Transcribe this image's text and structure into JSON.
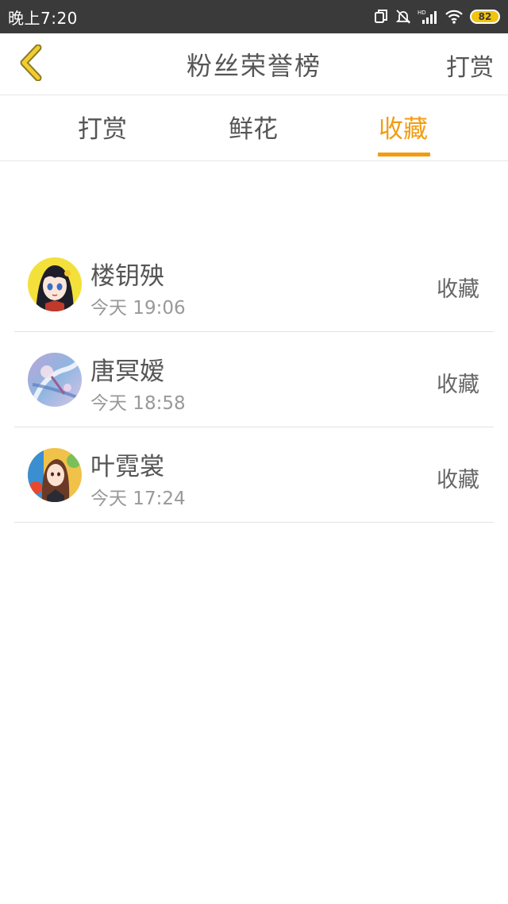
{
  "status_bar": {
    "time": "晚上7:20",
    "battery": "82",
    "icons": [
      "sim-icon",
      "bell-off-icon",
      "hd-signal-icon",
      "wifi-icon",
      "battery-icon"
    ]
  },
  "header": {
    "back_icon": "chevron-left-icon",
    "title": "粉丝荣誉榜",
    "action": "打赏"
  },
  "tabs": [
    {
      "label": "打赏",
      "active": false
    },
    {
      "label": "鲜花",
      "active": false
    },
    {
      "label": "收藏",
      "active": true
    }
  ],
  "list": [
    {
      "name": "楼钥殃",
      "time": "今天 19:06",
      "action": "收藏"
    },
    {
      "name": "唐冥嫒",
      "time": "今天 18:58",
      "action": "收藏"
    },
    {
      "name": "叶霓裳",
      "time": "今天 17:24",
      "action": "收藏"
    }
  ],
  "colors": {
    "accent": "#f39c12",
    "status_bar": "#3a3a3a",
    "text": "#555555",
    "subtext": "#999999",
    "divider": "#e6e6e6",
    "back_icon": "#e8c22c"
  }
}
